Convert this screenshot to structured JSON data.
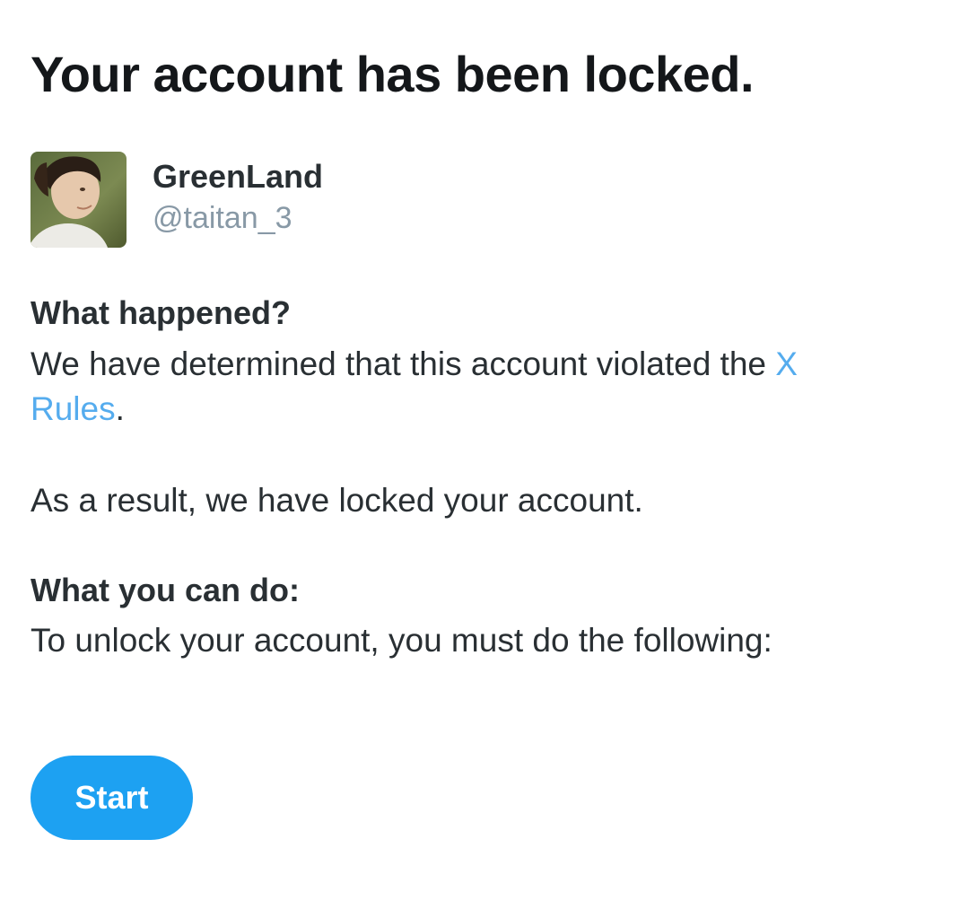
{
  "page": {
    "title": "Your account has been locked."
  },
  "profile": {
    "display_name": "GreenLand",
    "username": "@taitan_3",
    "avatar_icon": "user-avatar-photo"
  },
  "what_happened": {
    "heading": "What happened?",
    "text_before_link": "We have determined that this account violated the ",
    "link_text": "X Rules",
    "text_after_link": ".",
    "result_text": "As a result, we have locked your account."
  },
  "what_you_can_do": {
    "heading": "What you can do:",
    "text": "To unlock your account, you must do the following:"
  },
  "actions": {
    "start_label": "Start"
  },
  "colors": {
    "accent": "#1da1f2",
    "link": "#55acee",
    "text": "#292f33",
    "muted": "#8899a6"
  }
}
